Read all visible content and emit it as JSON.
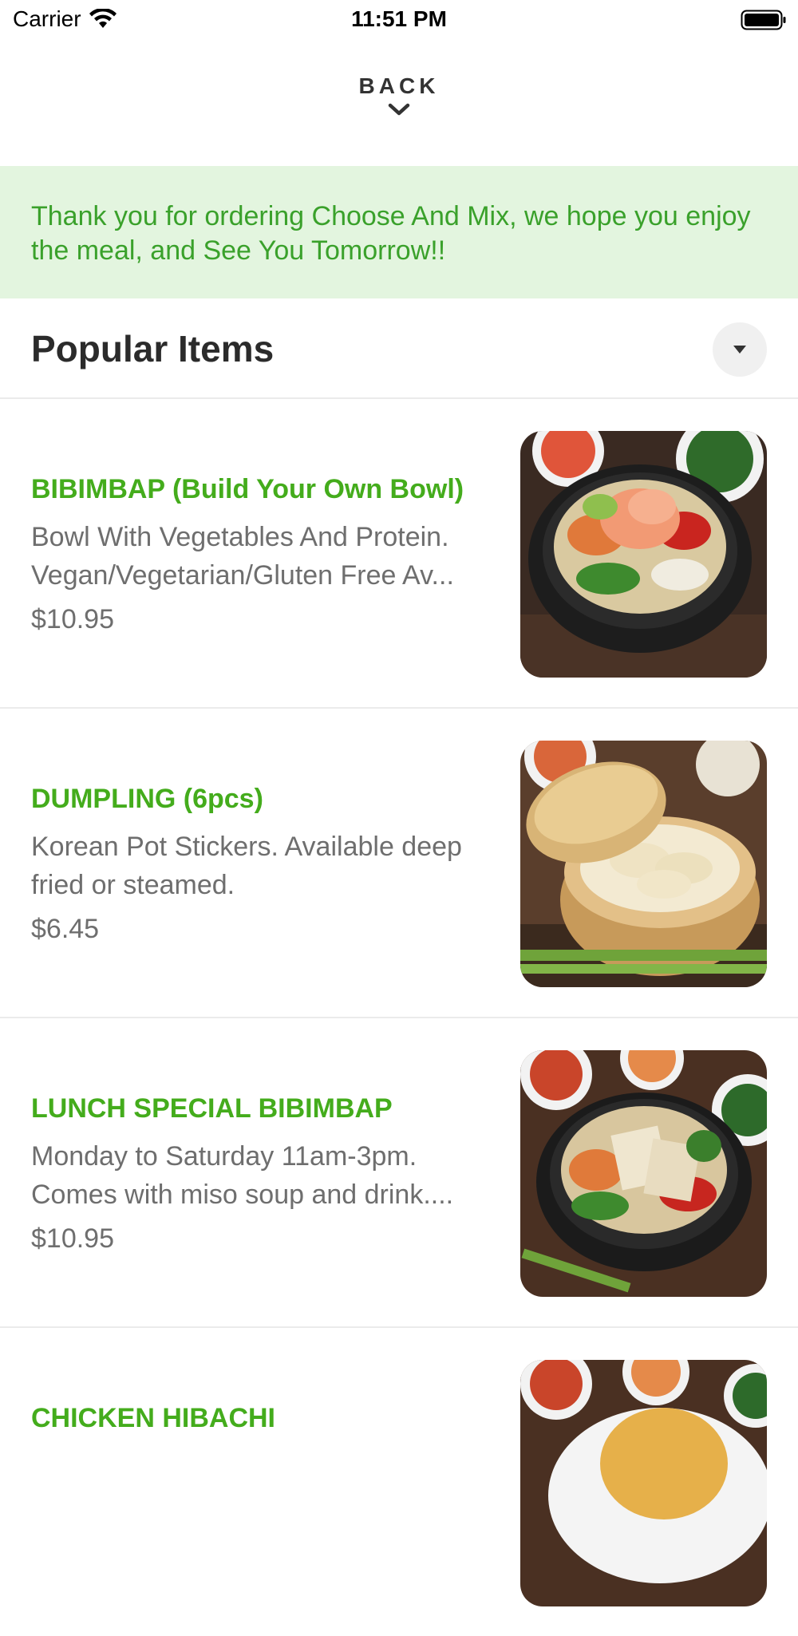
{
  "status_bar": {
    "carrier": "Carrier",
    "time": "11:51 PM"
  },
  "header": {
    "back_label": "BACK"
  },
  "banner": {
    "message": "Thank you for ordering Choose And Mix, we hope you enjoy the meal, and See You Tomorrow!!"
  },
  "section": {
    "title": "Popular Items"
  },
  "menu": {
    "items": [
      {
        "name": "BIBIMBAP (Build Your Own Bowl)",
        "description_line1": "Bowl With Vegetables And Protein.",
        "description_line2": "Vegan/Vegetarian/Gluten Free Av...",
        "price": "$10.95"
      },
      {
        "name": "DUMPLING (6pcs)",
        "description_line1": "Korean Pot Stickers. Available deep",
        "description_line2": "fried or steamed.",
        "price": "$6.45"
      },
      {
        "name": "LUNCH SPECIAL BIBIMBAP",
        "description_line1": "Monday to Saturday 11am-3pm.",
        "description_line2": "Comes with miso soup and drink....",
        "price": "$10.95"
      },
      {
        "name": "CHICKEN HIBACHI"
      }
    ]
  },
  "colors": {
    "accent_green": "#44ac1c",
    "banner_bg": "#e3f5df",
    "banner_text": "#3aa12b"
  }
}
